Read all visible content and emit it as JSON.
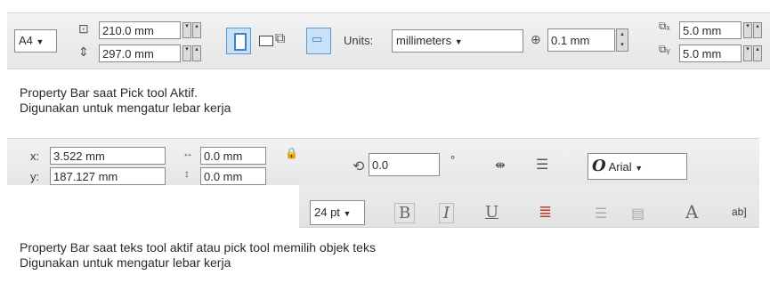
{
  "bar_pick": {
    "page_size": "A4",
    "width": "210.0 mm",
    "height": "297.0 mm",
    "units_label": "Units:",
    "units_value": "millimeters",
    "nudge": "0.1 mm",
    "dup_x": "5.0 mm",
    "dup_y": "5.0 mm"
  },
  "caption1": {
    "line1": "Property Bar saat Pick tool Aktif.",
    "line2": "Digunakan untuk mengatur lebar kerja"
  },
  "bar_text": {
    "x_label": "x:",
    "x_value": "3.522 mm",
    "y_label": "y:",
    "y_value": "187.127 mm",
    "w_value": "0.0 mm",
    "h_value": "0.0 mm",
    "rotation": "0.0",
    "degree": "°",
    "font_icon": "O",
    "font_name": "Arial",
    "font_size": "24 pt",
    "ab_label": "ab]"
  },
  "caption2": {
    "line1": "Property Bar saat teks tool aktif atau pick tool memilih objek teks",
    "line2": "Digunakan untuk mengatur lebar kerja"
  }
}
